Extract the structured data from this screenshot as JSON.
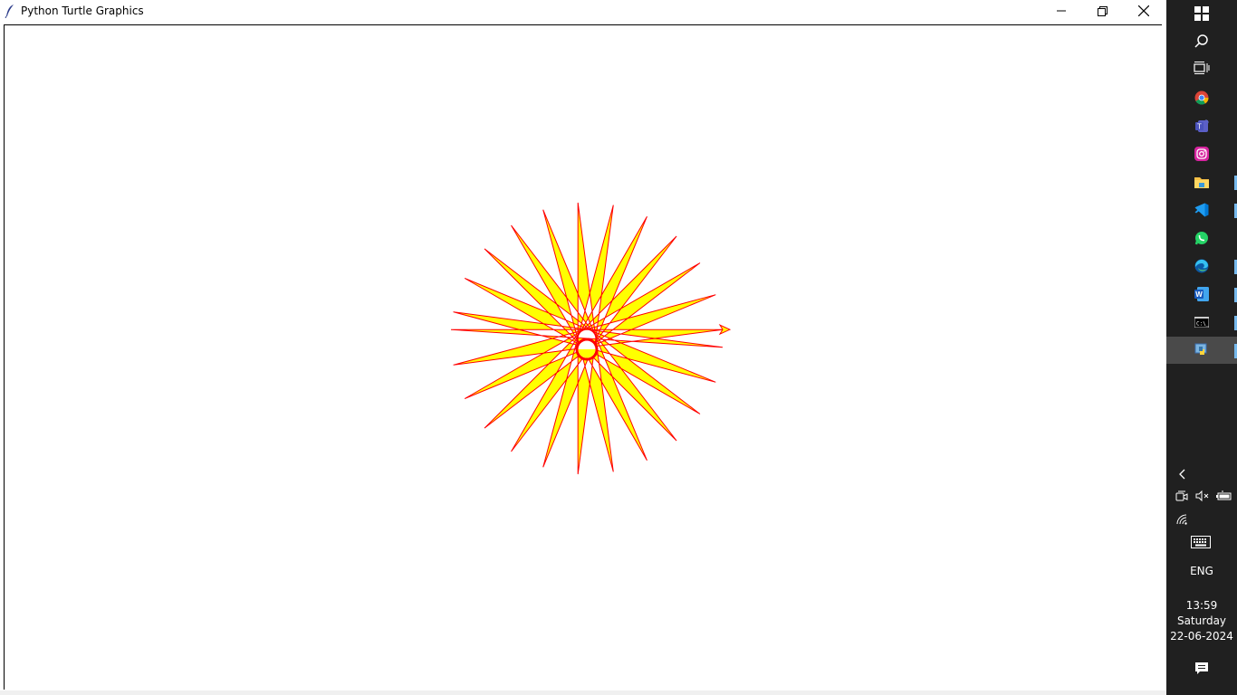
{
  "window": {
    "title": "Python Turtle Graphics",
    "controls": [
      "minimize",
      "restore",
      "close"
    ]
  },
  "drawing": {
    "shape": "star polygon with circle at center and turtle cursor",
    "points": 24,
    "fill_color": "#ffff00",
    "stroke_color": "#ff0000",
    "center_circle_fill": "#ffff00",
    "center_circle_stroke": "#ff0000"
  },
  "taskbar": {
    "apps": [
      {
        "name": "start",
        "icon": "windows-icon"
      },
      {
        "name": "search",
        "icon": "search-icon"
      },
      {
        "name": "task-view",
        "icon": "task-view-icon"
      },
      {
        "name": "chrome",
        "icon": "chrome-icon",
        "running": false
      },
      {
        "name": "teams",
        "icon": "teams-icon",
        "running": false
      },
      {
        "name": "instagram",
        "icon": "instagram-icon",
        "running": false
      },
      {
        "name": "file-explorer",
        "icon": "folder-icon",
        "running": true
      },
      {
        "name": "vscode",
        "icon": "vscode-icon",
        "running": true
      },
      {
        "name": "whatsapp",
        "icon": "whatsapp-icon",
        "running": false
      },
      {
        "name": "edge",
        "icon": "edge-icon",
        "running": true
      },
      {
        "name": "word",
        "icon": "word-icon",
        "running": true
      },
      {
        "name": "cmd",
        "icon": "terminal-icon",
        "running": true
      },
      {
        "name": "python",
        "icon": "python-icon",
        "running": true,
        "active": true
      }
    ],
    "tray": {
      "language": "ENG",
      "time": "13:59",
      "day": "Saturday",
      "date": "22-06-2024"
    }
  }
}
